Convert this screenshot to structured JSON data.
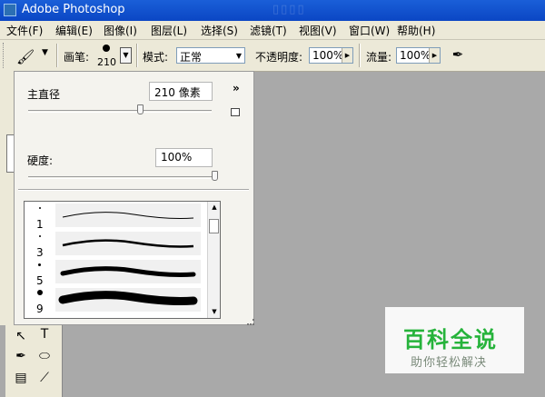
{
  "window": {
    "title": "Adobe Photoshop"
  },
  "menu": [
    "文件(F)",
    "编辑(E)",
    "图像(I)",
    "图层(L)",
    "选择(S)",
    "滤镜(T)",
    "视图(V)",
    "窗口(W)",
    "帮助(H)"
  ],
  "options": {
    "brush_label": "画笔:",
    "brush_size": "210",
    "mode_label": "模式:",
    "mode_value": "正常",
    "opacity_label": "不透明度:",
    "opacity_value": "100%",
    "flow_label": "流量:",
    "flow_value": "100%"
  },
  "brush_panel": {
    "diameter_label": "主直径",
    "diameter_value": "210 像素",
    "diameter_slider_fraction": 0.61,
    "hardness_label": "硬度:",
    "hardness_value": "100%",
    "hardness_slider_fraction": 1.0,
    "presets": [
      {
        "number": "1"
      },
      {
        "number": "3"
      },
      {
        "number": "5"
      },
      {
        "number": "9"
      }
    ]
  },
  "toolbox_labels": {
    "type_tool": "T"
  },
  "watermark": {
    "title": "百科全说",
    "subtitle": "助你轻松解决"
  },
  "colors": {
    "titlebar": "#0b46c4",
    "chrome": "#ece9d8",
    "canvas": "#a9a9a9",
    "watermark_green": "#26b33b"
  },
  "icons": [
    "brush-tool-icon",
    "dropdown-arrow-icon",
    "airbrush-icon",
    "expand-chevron-icon",
    "new-preset-icon"
  ]
}
